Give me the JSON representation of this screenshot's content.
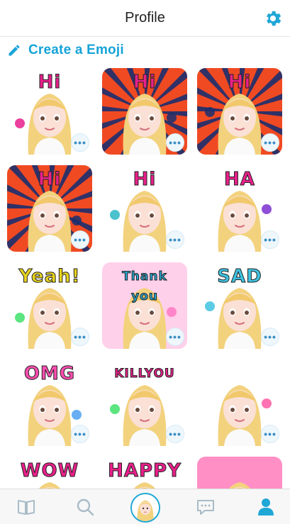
{
  "header": {
    "title": "Profile",
    "settings_icon": "gear-icon"
  },
  "create": {
    "label": "Create a Emoji",
    "icon": "pencil-icon"
  },
  "grid": {
    "more_glyph": "•••",
    "tiles": [
      {
        "caption": "Hi",
        "bg": "#ffffff",
        "accent": "#e81f8c",
        "capcolor": "#e81f8c"
      },
      {
        "caption": "Hi",
        "bg": "#f04a23",
        "accent": "#1b2f6e",
        "capcolor": "#e8208a"
      },
      {
        "caption": "Hi",
        "bg": "#f04a23",
        "accent": "#1b2f6e",
        "capcolor": "#e8208a"
      },
      {
        "caption": "Hi",
        "bg": "#f04a23",
        "accent": "#1b2f6e",
        "capcolor": "#e8208a"
      },
      {
        "caption": "Hi",
        "bg": "#ffffff",
        "accent": "#2bb7c6",
        "capcolor": "#e8208a"
      },
      {
        "caption": "HA",
        "bg": "#ffffff",
        "accent": "#7a2fd0",
        "capcolor": "#e8208a"
      },
      {
        "caption": "Yeah!",
        "bg": "#ffffff",
        "accent": "#3fe06a",
        "capcolor": "#e6d21e"
      },
      {
        "caption": "Thank you",
        "bg": "#ffd0ea",
        "accent": "#ff79c4",
        "capcolor": "#2aa9d2"
      },
      {
        "caption": "SAD",
        "bg": "#ffffff",
        "accent": "#3fc2e0",
        "capcolor": "#3fc2e0"
      },
      {
        "caption": "OMG",
        "bg": "#ffffff",
        "accent": "#4fa0f0",
        "capcolor": "#ff4db0"
      },
      {
        "caption": "KILLYOU",
        "bg": "#ffffff",
        "accent": "#3fe06a",
        "capcolor": "#e8208a"
      },
      {
        "caption": "",
        "bg": "#ffffff",
        "accent": "#ff5aa5",
        "capcolor": "#2bb7c6"
      },
      {
        "caption": "WOW",
        "bg": "#ffffff",
        "accent": "#2aa9d2",
        "capcolor": "#e8208a"
      },
      {
        "caption": "HAPPY",
        "bg": "#ffffff",
        "accent": "#ffd12a",
        "capcolor": "#e8208a"
      },
      {
        "caption": "",
        "bg": "#ff8fc4",
        "accent": "#ffc2e0",
        "capcolor": "#e8208a"
      }
    ]
  },
  "tabbar": {
    "items": [
      {
        "name": "tab-book",
        "icon": "book-icon"
      },
      {
        "name": "tab-search",
        "icon": "search-icon"
      },
      {
        "name": "tab-avatar",
        "icon": "avatar-icon"
      },
      {
        "name": "tab-chat",
        "icon": "chat-bubble-icon"
      },
      {
        "name": "tab-profile",
        "icon": "person-icon"
      }
    ],
    "active_color": "#1fa7d6",
    "inactive_color": "#a9bcc7"
  }
}
